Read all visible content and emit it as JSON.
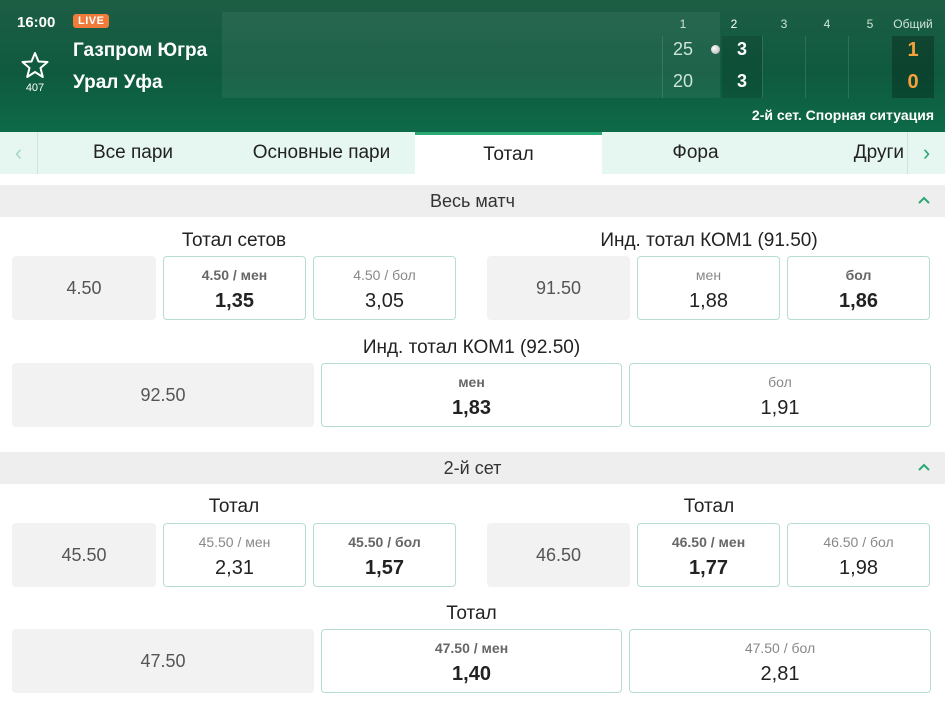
{
  "header": {
    "time": "16:00",
    "live_badge": "LIVE",
    "favorite_count": "407",
    "team1": "Газпром Югра",
    "team2": "Урал Уфа",
    "set_headers": [
      "1",
      "2",
      "3",
      "4",
      "5",
      "Общий"
    ],
    "team1_set_scores": [
      "25",
      "3"
    ],
    "team2_set_scores": [
      "20",
      "3"
    ],
    "team1_total": "1",
    "team2_total": "0",
    "status": "2-й сет. Спорная ситуация"
  },
  "tabs": [
    "Все пари",
    "Основные пари",
    "Тотал",
    "Фора",
    "Други"
  ],
  "active_tab": "Тотал",
  "sections": [
    {
      "title": "Весь матч",
      "markets": [
        {
          "title": "Тотал сетов",
          "param": "4.50",
          "under": {
            "label": "4.50 / мен",
            "odd": "1,35"
          },
          "over": {
            "label": "4.50 / бол",
            "odd": "3,05"
          }
        },
        {
          "title": "Инд. тотал КОМ1 (91.50)",
          "param": "91.50",
          "under": {
            "label": "мен",
            "odd": "1,88"
          },
          "over": {
            "label": "бол",
            "odd": "1,86"
          }
        },
        {
          "title": "Инд. тотал КОМ1 (92.50)",
          "param": "92.50",
          "under": {
            "label": "мен",
            "odd": "1,83"
          },
          "over": {
            "label": "бол",
            "odd": "1,91"
          }
        }
      ]
    },
    {
      "title": "2-й сет",
      "markets": [
        {
          "title": "Тотал",
          "param": "45.50",
          "under": {
            "label": "45.50 / мен",
            "odd": "2,31"
          },
          "over": {
            "label": "45.50 / бол",
            "odd": "1,57"
          }
        },
        {
          "title": "Тотал",
          "param": "46.50",
          "under": {
            "label": "46.50 / мен",
            "odd": "1,77"
          },
          "over": {
            "label": "46.50 / бол",
            "odd": "1,98"
          }
        },
        {
          "title": "Тотал",
          "param": "47.50",
          "under": {
            "label": "47.50 / мен",
            "odd": "1,40"
          },
          "over": {
            "label": "47.50 / бол",
            "odd": "2,81"
          }
        }
      ]
    }
  ],
  "colors": {
    "header_green": "#0f5a3f",
    "accent_green": "#2aa874",
    "score_orange": "#f7a13a",
    "live_orange": "#f07b3a"
  },
  "icons": [
    "star-icon",
    "chevron-left-icon",
    "chevron-right-icon",
    "chevron-up-icon",
    "serve-ball-icon"
  ]
}
